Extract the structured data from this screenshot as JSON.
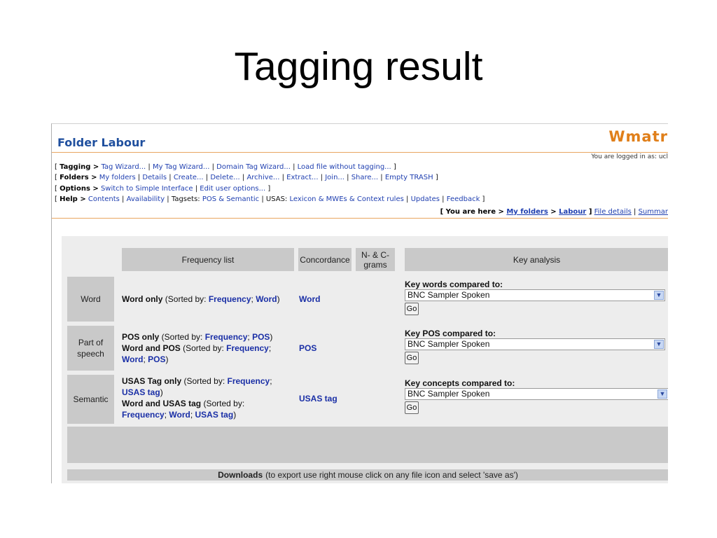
{
  "slide": {
    "title": "Tagging result"
  },
  "app": {
    "brand": "Wmatr",
    "folder_title": "Folder Labour",
    "logged_in": "You are logged in as: ucl"
  },
  "menu": {
    "tagging": {
      "label": "Tagging >",
      "items": [
        "Tag Wizard...",
        "My Tag Wizard...",
        "Domain Tag Wizard...",
        "Load file without tagging..."
      ]
    },
    "folders": {
      "label": "Folders >",
      "items": [
        "My folders",
        "Details",
        "Create...",
        "Delete...",
        "Archive...",
        "Extract...",
        "Join...",
        "Share...",
        "Empty TRASH"
      ]
    },
    "options": {
      "label": "Options >",
      "items": [
        "Switch to Simple Interface",
        "Edit user options..."
      ]
    },
    "help": {
      "label": "Help >",
      "items": [
        "Contents",
        "Availability"
      ],
      "tagsets_label": "Tagsets:",
      "tagsets_value": "POS & Semantic",
      "usas_label": "USAS:",
      "usas_value": "Lexicon & MWEs & Context rules",
      "items2": [
        "Updates",
        "Feedback"
      ]
    }
  },
  "breadcrumb": {
    "prefix": "You are here >",
    "my_folders": "My folders",
    "sep": ">",
    "labour": "Labour",
    "file_details": "File details",
    "summary": "Summar"
  },
  "table": {
    "headers": {
      "frequency": "Frequency list",
      "concordance": "Concordance",
      "ngrams": "N- & C-grams",
      "key": "Key analysis"
    },
    "rows": {
      "word": {
        "label": "Word",
        "freq_bold": "Word only",
        "freq_pre": " (Sorted by: ",
        "link1": "Frequency",
        "sep": "; ",
        "link2": "Word",
        "freq_post": ")",
        "concordance": "Word",
        "key_label": "Key words compared to:",
        "select": "BNC Sampler Spoken",
        "go": "Go"
      },
      "pos": {
        "label": "Part of speech",
        "line1_bold": "POS only",
        "line1_pre": " (Sorted by: ",
        "line1_link1": "Frequency",
        "sep": "; ",
        "line1_link2": "POS",
        "line1_post": ")",
        "line2_bold": "Word and POS",
        "line2_pre": " (Sorted by: ",
        "line2_link1": "Frequency",
        "line2_link2": "Word",
        "line2_link3": "POS",
        "line2_post": ")",
        "concordance": "POS",
        "key_label": "Key POS compared to:",
        "select": "BNC Sampler Spoken",
        "go": "Go"
      },
      "semantic": {
        "label": "Semantic",
        "line1_bold": "USAS Tag only",
        "line1_pre": " (Sorted by: ",
        "line1_link1": "Frequency",
        "sep": ";",
        "line1_link2": "USAS tag",
        "line1_post": ")",
        "line2_bold": "Word and USAS tag",
        "line2_pre": " (Sorted by:",
        "line2_link1": "Frequency",
        "line2_link2": "Word",
        "line2_link3": "USAS tag",
        "line2_post": ")",
        "concordance": "USAS tag",
        "key_label": "Key concepts compared to:",
        "select": "BNC Sampler Spoken",
        "go": "Go"
      }
    }
  },
  "downloads": {
    "label": "Downloads",
    "note": "(to export use right mouse click on any file icon and select 'save as')"
  },
  "colors": {
    "brand": "#e07f1a",
    "folder_title": "#1f4f9e",
    "link": "#1a2fa6",
    "header_bg": "#c9c9c9"
  }
}
